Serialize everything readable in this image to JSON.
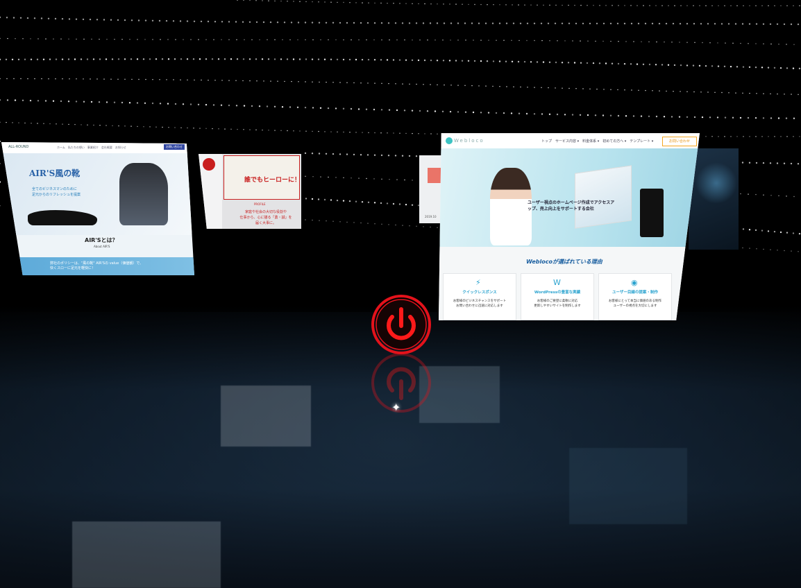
{
  "cards": {
    "airs": {
      "logo": "ALL-ROUND",
      "nav": "ホーム　私たちの想い　事業紹介　会社概要　お知らせ",
      "contact": "お問い合わせ",
      "title": "AIR'S風の靴",
      "subtitle": "全てのビジネスマンのために\n足元からのリフレッシュを提案",
      "section_title": "AIR'Sとは？",
      "section_sub": "About AIR'S",
      "band_text": "弊社のポリシーは、\"風の靴\" AIR'Sの value（価値観）で、\n快くスローに足元を軽快に！"
    },
    "hero_poster": {
      "poster_text": "誰でもヒーローに！",
      "label": "PROFILE",
      "copy": "家庭や社会の大切な役割や\n仕事から、心に描る「勇・誠」を\n届く大事に。"
    },
    "sliver": {
      "text": "2019.10"
    },
    "webloco": {
      "brand": "Webloco",
      "menu": "トップ　サービス内容 ▾　料金体系 ▾　初めての方へ ▾　テンプレート ▾",
      "cta": "お問い合わせ",
      "headline": "ユーザー視点のホームページ作成でアクセスアップ、売上向上をサポートする会社",
      "why_title": "Weblocoが選ばれている理由",
      "columns": [
        {
          "icon": "⚡",
          "title": "クイックレスポンス",
          "desc": "お客様のビジネスチャンスをサポート\nお問い合わせに迅速に対応します"
        },
        {
          "icon": "W",
          "title": "WordPressの豊富な実績",
          "desc": "お客様のご要望に柔軟に対応\n更新しやすいサイトを制作します"
        },
        {
          "icon": "◉",
          "title": "ユーザー目線の提案・制作",
          "desc": "お客様にとって本当に価値のある制作\nユーザーの視点を大切にします"
        }
      ]
    }
  },
  "power": {
    "label": "power-button",
    "color": "#e3121b"
  },
  "colors": {
    "floor": "#16283a",
    "sky": "#000000",
    "dots": "#ffffff"
  }
}
